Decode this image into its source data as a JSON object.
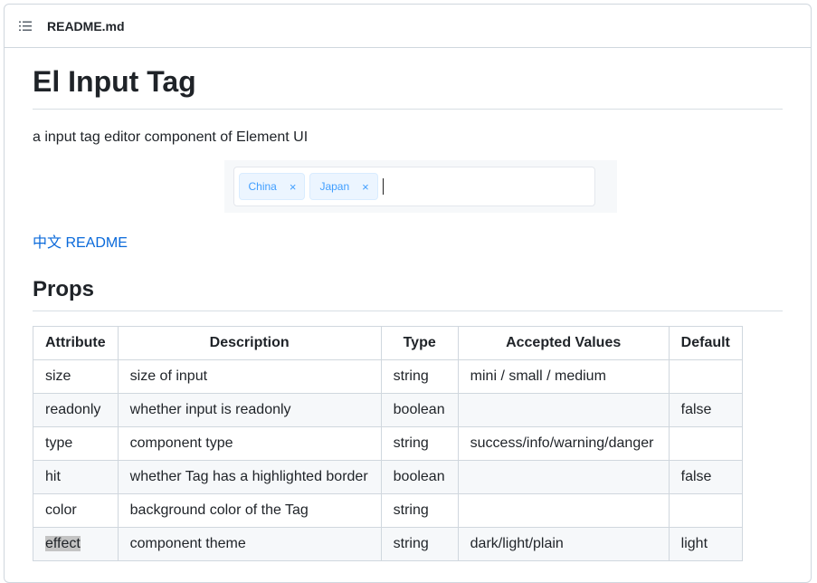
{
  "header": {
    "file_name": "README.md",
    "icon": "list-icon"
  },
  "page": {
    "title": "El Input Tag",
    "description": "a input tag editor component of Element UI",
    "demo": {
      "tags": [
        {
          "label": "China",
          "close": "×"
        },
        {
          "label": "Japan",
          "close": "×"
        }
      ]
    },
    "readme_link": "中文 README",
    "props_heading": "Props"
  },
  "table": {
    "headers": [
      "Attribute",
      "Description",
      "Type",
      "Accepted Values",
      "Default"
    ],
    "rows": [
      [
        "size",
        "size of input",
        "string",
        "mini / small / medium",
        ""
      ],
      [
        "readonly",
        "whether input is readonly",
        "boolean",
        "",
        "false"
      ],
      [
        "type",
        "component type",
        "string",
        "success/info/warning/danger",
        ""
      ],
      [
        "hit",
        "whether Tag has a highlighted border",
        "boolean",
        "",
        "false"
      ],
      [
        "color",
        "background color of the Tag",
        "string",
        "",
        ""
      ],
      [
        "effect",
        "component theme",
        "string",
        "dark/light/plain",
        "light"
      ]
    ]
  },
  "colors": {
    "link": "#0969da",
    "tag_text": "#409eff",
    "tag_bg": "#ecf5ff",
    "border": "#d0d7de"
  }
}
